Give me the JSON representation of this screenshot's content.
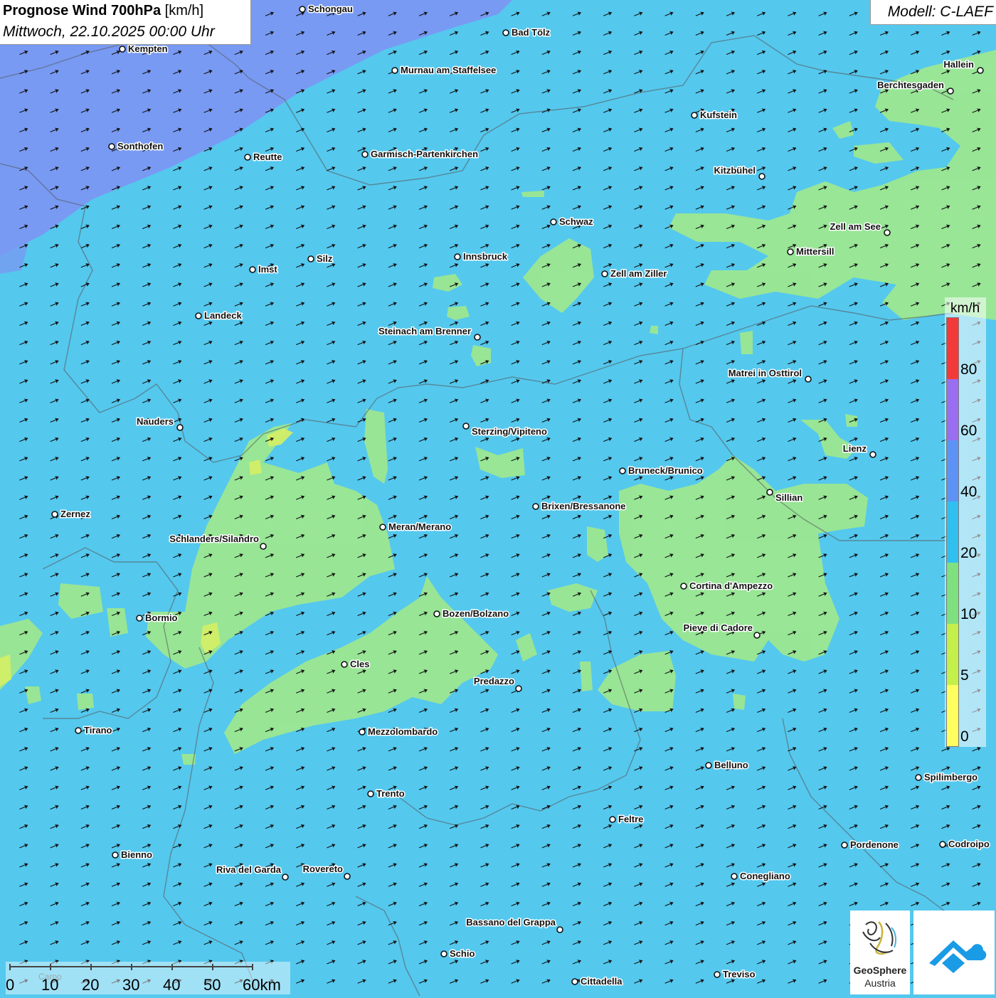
{
  "title": {
    "main": "Prognose Wind 700hPa",
    "unit": "[km/h]",
    "datetime": "Mittwoch, 22.10.2025 00:00 Uhr"
  },
  "model": "Modell: C-LAEF",
  "legend": {
    "unit": "km/h",
    "ticks": [
      "80",
      "60",
      "40",
      "20",
      "10",
      "5",
      "0"
    ],
    "colors": [
      "#f23a3a",
      "#9a6ef0",
      "#5c93f5",
      "#2fc0f0",
      "#7fe07f",
      "#c3f04a",
      "#ffff60"
    ]
  },
  "scale_bar": {
    "labels": [
      "0",
      "10",
      "20",
      "30",
      "40",
      "50",
      "60km"
    ],
    "faint_label": "Carpo"
  },
  "logos": {
    "geosphere_name": "GeoSphere",
    "geosphere_sub": "Austria",
    "geosphere_icon": "geosphere-swirl-icon",
    "app_icon": "cloud-chevron-icon"
  },
  "colors": {
    "wind_10_20": "#9ee88e",
    "wind_20_40": "#55c8ee",
    "wind_40_60": "#7a98f2",
    "wind_5_10": "#d2ee66",
    "wind_arrow": "#111111"
  },
  "cities": [
    "Schongau",
    "Bad Tölz",
    "Kempten",
    "Murnau am Staffelsee",
    "Hallein",
    "Berchtesgaden",
    "Kufstein",
    "Sonthofen",
    "Reutte",
    "Garmisch-Partenkirchen",
    "Kitzbühel",
    "Schwaz",
    "Zell am See",
    "Mittersill",
    "Innsbruck",
    "Silz",
    "Imst",
    "Zell am Ziller",
    "Landeck",
    "Steinach am Brenner",
    "Matrei in Osttirol",
    "Nauders",
    "Sterzing/Vipiteno",
    "Lienz",
    "Bruneck/Brunico",
    "Sillian",
    "Zernez",
    "Brixen/Bressanone",
    "Meran/Merano",
    "Schlanders/Silandro",
    "Cortina d'Ampezzo",
    "Bozen/Bolzano",
    "Bormio",
    "Pieve di Cadore",
    "Cles",
    "Predazzo",
    "Tirano",
    "Mezzolombardo",
    "Belluno",
    "Spilimbergo",
    "Trento",
    "Feltre",
    "Pordenone",
    "Codroipo",
    "Bienno",
    "Riva del Garda",
    "Rovereto",
    "Conegliano",
    "Bassano del Grappa",
    "Schio",
    "Treviso",
    "Cittadella"
  ]
}
